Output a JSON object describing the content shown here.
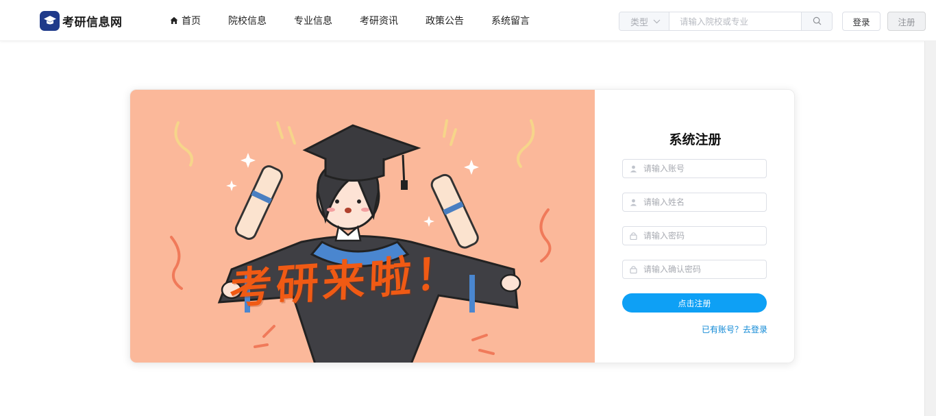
{
  "header": {
    "site_name": "考研信息网",
    "nav": [
      {
        "label": "首页"
      },
      {
        "label": "院校信息"
      },
      {
        "label": "专业信息"
      },
      {
        "label": "考研资讯"
      },
      {
        "label": "政策公告"
      },
      {
        "label": "系统留言"
      }
    ],
    "search": {
      "type_label": "类型",
      "placeholder": "请输入院校或专业"
    },
    "login_label": "登录",
    "register_label": "注册"
  },
  "banner": {
    "slogan": "考研来啦！"
  },
  "form": {
    "title": "系统注册",
    "account_placeholder": "请输入账号",
    "name_placeholder": "请输入姓名",
    "password_placeholder": "请输入密码",
    "confirm_placeholder": "请输入确认密码",
    "submit_label": "点击注册",
    "login_link": "已有账号？去登录"
  },
  "colors": {
    "primary": "#0ea0f5",
    "illustration_bg": "#fbb89a",
    "slogan": "#f05a14",
    "logo": "#1f3a8a"
  }
}
